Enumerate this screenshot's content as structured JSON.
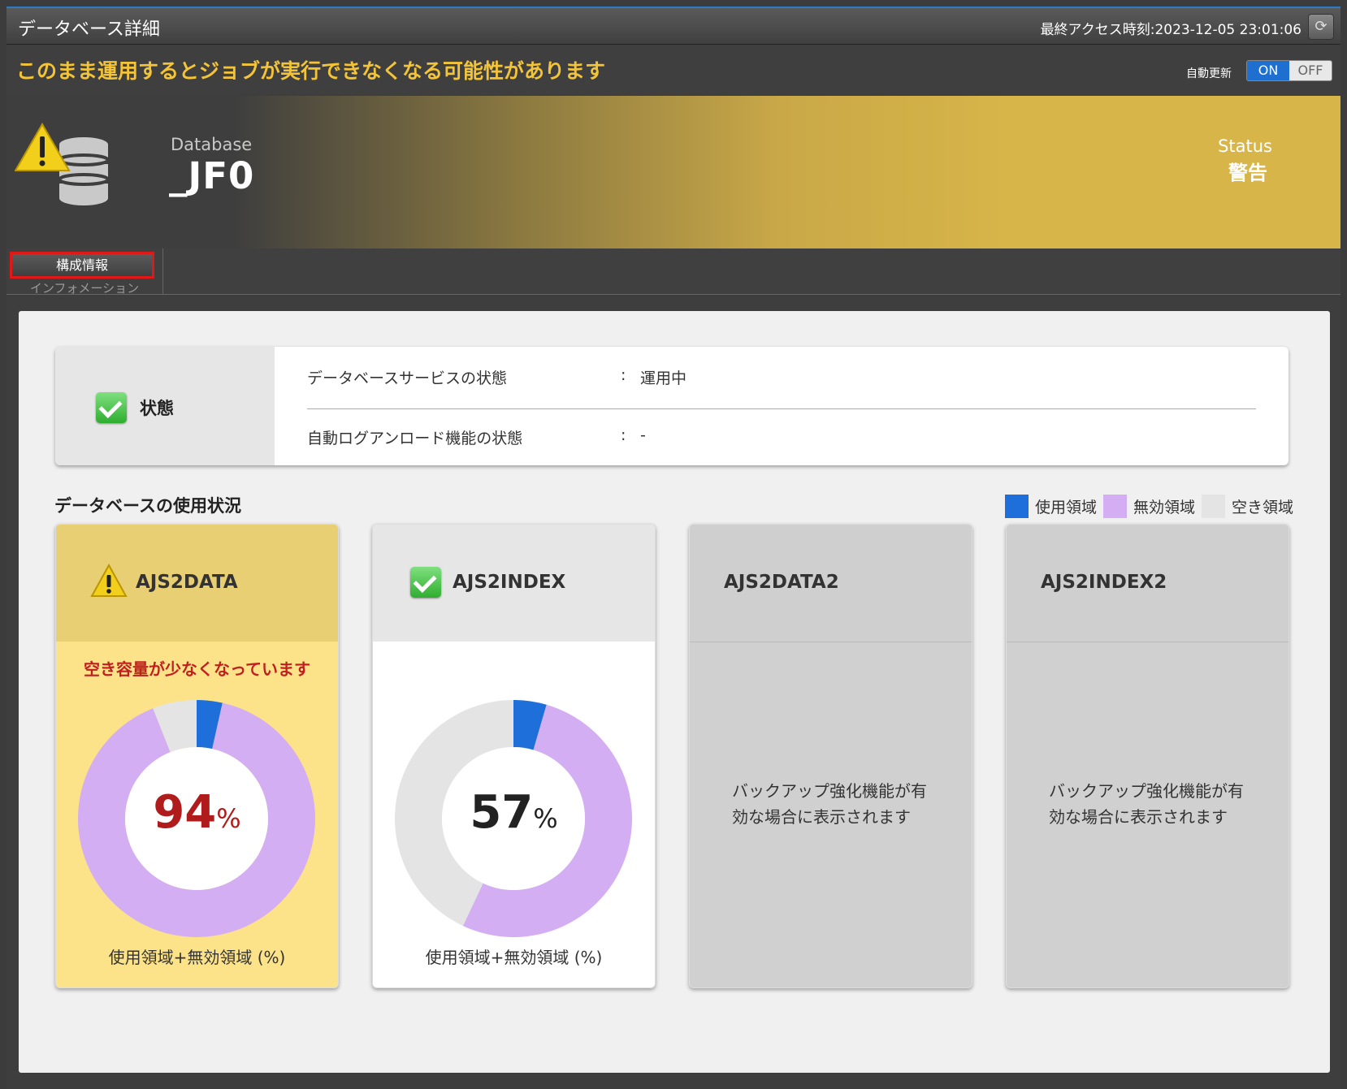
{
  "window": {
    "title": "データベース詳細",
    "last_access": "最終アクセス時刻:2023-12-05 23:01:06",
    "refresh_icon": "refresh-icon"
  },
  "warning_banner": {
    "message": "このまま運用するとジョブが実行できなくなる可能性があります",
    "auto_update_label": "自動更新",
    "toggle_on": "ON",
    "toggle_off": "OFF",
    "selected": "ON"
  },
  "header": {
    "db_label": "Database",
    "db_name": "_JF0",
    "status_label": "Status",
    "status_value": "警告",
    "icon": "database-warning-icon",
    "accent_color": "#d7b549"
  },
  "tabs": [
    {
      "label": "構成情報",
      "sublabel": "インフォメーション"
    }
  ],
  "status_panel": {
    "title": "状態",
    "rows": [
      {
        "label": "データベースサービスの状態",
        "colon": ":",
        "value": "運用中"
      },
      {
        "label": "自動ログアンロード機能の状態",
        "colon": ":",
        "value": "-"
      }
    ]
  },
  "usage": {
    "title": "データベースの使用状況",
    "legend": [
      {
        "label": "使用領域",
        "color": "#1e6fd9"
      },
      {
        "label": "無効領域",
        "color": "#d4aef2"
      },
      {
        "label": "空き領域",
        "color": "#e4e4e4"
      }
    ],
    "cards": [
      {
        "name": "AJS2DATA",
        "state": "warning",
        "warning_message": "空き容量が少なくなっています",
        "percent": "94",
        "unit": "%",
        "footer": "使用領域+無効領域 (%)",
        "segments": {
          "used": 3.5,
          "invalid": 90.5,
          "free": 6
        }
      },
      {
        "name": "AJS2INDEX",
        "state": "ok",
        "percent": "57",
        "unit": "%",
        "footer": "使用領域+無効領域 (%)",
        "segments": {
          "used": 4.5,
          "invalid": 52.5,
          "free": 43
        }
      },
      {
        "name": "AJS2DATA2",
        "state": "disabled",
        "note": "バックアップ強化機能が有効な場合に表示されます"
      },
      {
        "name": "AJS2INDEX2",
        "state": "disabled",
        "note": "バックアップ強化機能が有効な場合に表示されます"
      }
    ]
  }
}
